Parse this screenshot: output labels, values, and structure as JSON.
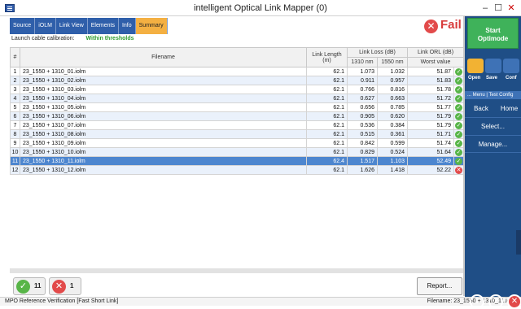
{
  "window": {
    "title": "intelligent Optical Link Mapper (0)"
  },
  "tabs": [
    {
      "label": "Source",
      "active": false
    },
    {
      "label": "iOLM",
      "active": false
    },
    {
      "label": "Link View",
      "active": false
    },
    {
      "label": "Elements",
      "active": false
    },
    {
      "label": "Info",
      "active": false
    },
    {
      "label": "Summary",
      "active": true
    }
  ],
  "status": {
    "fail_label": "Fail",
    "fail_icon": "x-circle-icon",
    "fail_color": "#d83b3b"
  },
  "calibration": {
    "label": "Launch cable calibration:",
    "value": "Within thresholds",
    "value_color": "#2e9b2e"
  },
  "table": {
    "headers": {
      "index": "#",
      "filename": "Filename",
      "link_length": "Link Length",
      "link_length_unit": "(m)",
      "link_loss_group": "Link Loss (dB)",
      "loss_1310": "1310 nm",
      "loss_1550": "1550 nm",
      "orl_group": "Link ORL (dB)",
      "orl_worst": "Worst value"
    },
    "rows": [
      {
        "idx": "1",
        "file": "23_1550 + 1310_01.iolm",
        "length": "62.1",
        "l1310": "1.073",
        "l1550": "1.032",
        "orl": "51.87",
        "status": "pass"
      },
      {
        "idx": "2",
        "file": "23_1550 + 1310_02.iolm",
        "length": "62.1",
        "l1310": "0.911",
        "l1550": "0.957",
        "orl": "51.83",
        "status": "pass"
      },
      {
        "idx": "3",
        "file": "23_1550 + 1310_03.iolm",
        "length": "62.1",
        "l1310": "0.766",
        "l1550": "0.816",
        "orl": "51.78",
        "status": "pass"
      },
      {
        "idx": "4",
        "file": "23_1550 + 1310_04.iolm",
        "length": "62.1",
        "l1310": "0.627",
        "l1550": "0.663",
        "orl": "51.72",
        "status": "pass"
      },
      {
        "idx": "5",
        "file": "23_1550 + 1310_05.iolm",
        "length": "62.1",
        "l1310": "0.656",
        "l1550": "0.785",
        "orl": "51.77",
        "status": "pass"
      },
      {
        "idx": "6",
        "file": "23_1550 + 1310_06.iolm",
        "length": "62.1",
        "l1310": "0.905",
        "l1550": "0.620",
        "orl": "51.79",
        "status": "pass"
      },
      {
        "idx": "7",
        "file": "23_1550 + 1310_07.iolm",
        "length": "62.1",
        "l1310": "0.536",
        "l1550": "0.384",
        "orl": "51.79",
        "status": "pass"
      },
      {
        "idx": "8",
        "file": "23_1550 + 1310_08.iolm",
        "length": "62.1",
        "l1310": "0.515",
        "l1550": "0.361",
        "orl": "51.71",
        "status": "pass"
      },
      {
        "idx": "9",
        "file": "23_1550 + 1310_09.iolm",
        "length": "62.1",
        "l1310": "0.842",
        "l1550": "0.599",
        "orl": "51.74",
        "status": "pass"
      },
      {
        "idx": "10",
        "file": "23_1550 + 1310_10.iolm",
        "length": "62.1",
        "l1310": "0.829",
        "l1550": "0.524",
        "orl": "51.64",
        "status": "pass"
      },
      {
        "idx": "11",
        "file": "23_1550 + 1310_11.iolm",
        "length": "62.4",
        "l1310": "1.517",
        "l1550": "1.103",
        "orl": "52.49",
        "status": "pass",
        "selected": true
      },
      {
        "idx": "12",
        "file": "23_1550 + 1310_12.iolm",
        "length": "62.1",
        "l1310": "1.626",
        "l1550": "1.418",
        "orl": "52.22",
        "status": "fail"
      }
    ]
  },
  "summary_badges": {
    "pass_count": "11",
    "fail_count": "1",
    "pass_color": "#58b548",
    "fail_color": "#e24a4a"
  },
  "report_button": "Report...",
  "statusbar": {
    "left": "MPO Reference Verification [Fast Short Link]",
    "right": "Filename: 23_1550 + 1310_11.iolm"
  },
  "side_panel": {
    "start_line1": "Start",
    "start_line2": "Optimode",
    "open": "Open",
    "save": "Save",
    "config": "Conf",
    "menu_bar": "... Menu | Test Config",
    "back": "Back",
    "home": "Home",
    "select": "Select...",
    "manage": "Manage...",
    "panel_color": "#1f4e86",
    "start_color": "#3fb25a"
  },
  "window_controls": {
    "minimize": "–",
    "maximize": "☐",
    "close": "✕"
  }
}
